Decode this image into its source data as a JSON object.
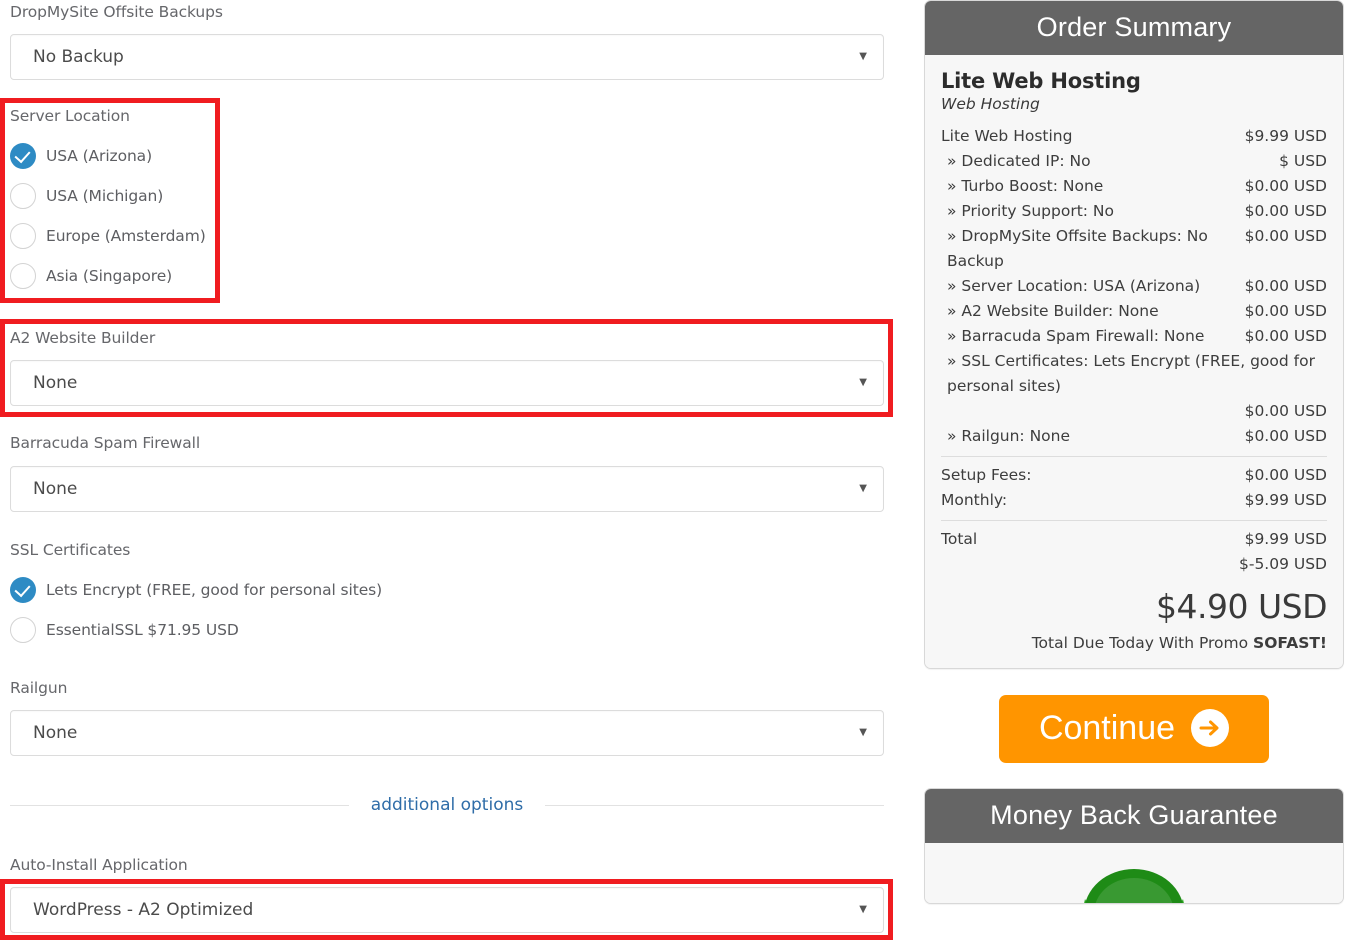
{
  "left_form": {
    "fields": [
      {
        "label": "DropMySite Offsite Backups",
        "type": "select",
        "value": "No Backup",
        "caret": "▼"
      },
      {
        "label": "Server Location",
        "type": "radio",
        "options": [
          {
            "label": "USA (Arizona)",
            "selected": true
          },
          {
            "label": "USA (Michigan)",
            "selected": false
          },
          {
            "label": "Europe (Amsterdam)",
            "selected": false
          },
          {
            "label": "Asia (Singapore)",
            "selected": false
          }
        ]
      },
      {
        "label": "A2 Website Builder",
        "type": "select",
        "value": "None",
        "caret": "▼"
      },
      {
        "label": "Barracuda Spam Firewall",
        "type": "select",
        "value": "None",
        "caret": "▼"
      },
      {
        "label": "SSL Certificates",
        "type": "radio",
        "options": [
          {
            "label": "Lets Encrypt (FREE, good for personal sites)",
            "selected": true
          },
          {
            "label": "EssentialSSL $71.95 USD",
            "selected": false
          }
        ]
      },
      {
        "label": "Railgun",
        "type": "select",
        "value": "None",
        "caret": "▼"
      }
    ],
    "divider_text": "additional options",
    "auto_install": {
      "label": "Auto-Install Application",
      "value": "WordPress - A2 Optimized",
      "caret": "▼"
    }
  },
  "order_summary": {
    "header": "Order Summary",
    "product_title": "Lite Web Hosting",
    "product_subtitle": "Web Hosting",
    "line_items": [
      {
        "name": "Lite Web Hosting",
        "amount": "$9.99 USD",
        "sub": false
      },
      {
        "name": "» Dedicated IP: No",
        "amount": "$ USD",
        "sub": true
      },
      {
        "name": "» Turbo Boost: None",
        "amount": "$0.00 USD",
        "sub": true
      },
      {
        "name": "» Priority Support: No",
        "amount": "$0.00 USD",
        "sub": true
      },
      {
        "name": "» DropMySite Offsite Backups: No Backup",
        "amount": "$0.00 USD",
        "sub": true
      },
      {
        "name": "» Server Location: USA (Arizona)",
        "amount": "$0.00 USD",
        "sub": true
      },
      {
        "name": "» A2 Website Builder: None",
        "amount": "$0.00 USD",
        "sub": true
      },
      {
        "name": "» Barracuda Spam Firewall: None",
        "amount": "$0.00 USD",
        "sub": true
      },
      {
        "name": "» SSL Certificates: Lets Encrypt (FREE, good for personal sites)",
        "amount": "$0.00 USD",
        "sub": true
      },
      {
        "name": "» Railgun: None",
        "amount": "$0.00 USD",
        "sub": true
      }
    ],
    "fees": [
      {
        "name": "Setup Fees:",
        "amount": "$0.00 USD"
      },
      {
        "name": "Monthly:",
        "amount": "$9.99 USD"
      }
    ],
    "totals": [
      {
        "name": "Total",
        "amount": "$9.99 USD"
      },
      {
        "name": "",
        "amount": "$-5.09 USD"
      }
    ],
    "grand_total": "$4.90 USD",
    "promo_prefix": "Total Due Today With Promo ",
    "promo_code": "SOFAST!"
  },
  "continue_button": {
    "label": "Continue",
    "icon": "arrow-right-circle-icon"
  },
  "money_back": {
    "header": "Money Back Guarantee"
  },
  "colors": {
    "accent_blue": "#2e8bc4",
    "highlight_red": "#f01c20",
    "continue_orange": "#ff9500",
    "panel_header_gray": "#656565",
    "seal_green": "#2aa81f"
  }
}
